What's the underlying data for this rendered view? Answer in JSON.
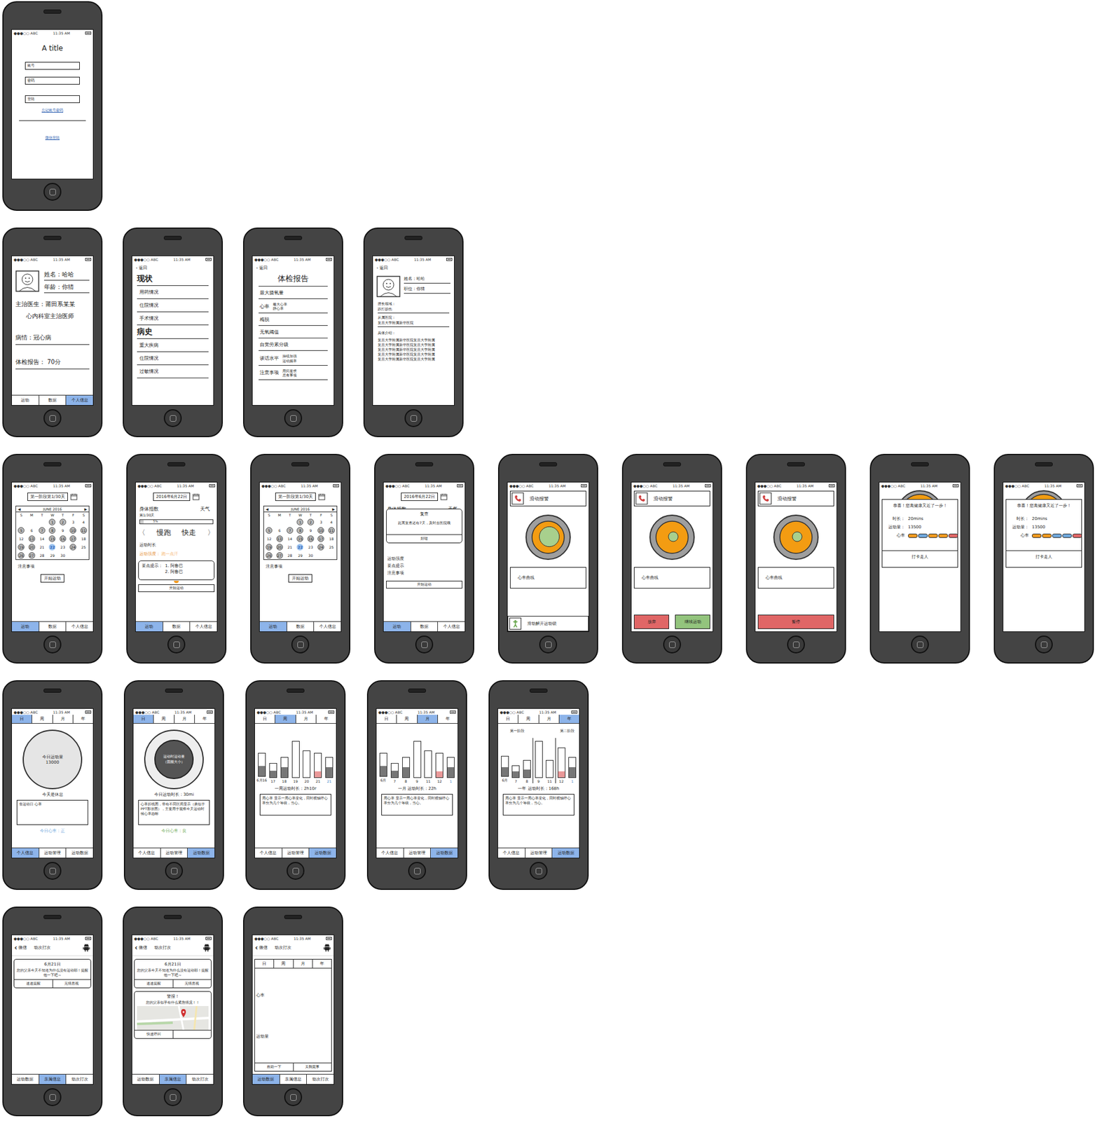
{
  "status_bar": {
    "carrier": "●●●○○ ABC",
    "time": "11:35 AM"
  },
  "calendar": {
    "month": "JUNE 2016",
    "prev": "◀",
    "next": "▶",
    "weekdays": [
      "S",
      "M",
      "T",
      "W",
      "T",
      "F",
      "S"
    ],
    "days": [
      {
        "d": "",
        "done": false,
        "selected": false
      },
      {
        "d": "",
        "done": false,
        "selected": false
      },
      {
        "d": "",
        "done": false,
        "selected": false
      },
      {
        "d": "1",
        "done": true,
        "selected": false
      },
      {
        "d": "2",
        "done": true,
        "selected": false
      },
      {
        "d": "3",
        "done": false,
        "selected": false
      },
      {
        "d": "4",
        "done": false,
        "selected": false
      },
      {
        "d": "5",
        "done": true,
        "selected": false
      },
      {
        "d": "6",
        "done": false,
        "selected": false
      },
      {
        "d": "7",
        "done": true,
        "selected": false
      },
      {
        "d": "8",
        "done": true,
        "selected": false
      },
      {
        "d": "9",
        "done": false,
        "selected": false
      },
      {
        "d": "10",
        "done": true,
        "selected": false
      },
      {
        "d": "11",
        "done": true,
        "selected": false
      },
      {
        "d": "12",
        "done": false,
        "selected": false
      },
      {
        "d": "13",
        "done": true,
        "selected": false
      },
      {
        "d": "14",
        "done": false,
        "selected": false
      },
      {
        "d": "15",
        "done": true,
        "selected": false
      },
      {
        "d": "16",
        "done": true,
        "selected": false
      },
      {
        "d": "17",
        "done": true,
        "selected": false
      },
      {
        "d": "18",
        "done": false,
        "selected": false
      },
      {
        "d": "19",
        "done": true,
        "selected": false
      },
      {
        "d": "20",
        "done": true,
        "selected": false
      },
      {
        "d": "21",
        "done": false,
        "selected": false
      },
      {
        "d": "22",
        "done": false,
        "selected": true
      },
      {
        "d": "23",
        "done": false,
        "selected": false
      },
      {
        "d": "24",
        "done": true,
        "selected": false
      },
      {
        "d": "25",
        "done": false,
        "selected": false
      },
      {
        "d": "26",
        "done": true,
        "selected": false
      },
      {
        "d": "27",
        "done": true,
        "selected": false
      },
      {
        "d": "28",
        "done": false,
        "selected": false
      },
      {
        "d": "29",
        "done": false,
        "selected": false
      },
      {
        "d": "30",
        "done": false,
        "selected": false
      }
    ]
  },
  "screens": [
    {
      "kind": "login",
      "title": "A title",
      "fields": [
        "账号",
        "密码"
      ],
      "button": "登陆",
      "forgot": "忘记账号密码",
      "wechat": "微信登陆"
    },
    {
      "kind": "profile",
      "name": "姓名：哈哈",
      "age": "年龄：你猜",
      "doctor": "主治医生：莆田系某某",
      "dept": "心内科室主治医师",
      "illness": "病情：冠心病",
      "report": "体检报告： 70分",
      "tabs": [
        {
          "label": "运动",
          "selected": false
        },
        {
          "label": "数据",
          "selected": false
        },
        {
          "label": "个人信息",
          "selected": true
        }
      ]
    },
    {
      "kind": "history",
      "back": "返回",
      "sections": [
        {
          "title": "现状",
          "items": [
            "用药情况",
            "住院情况",
            "手术情况"
          ]
        },
        {
          "title": "病史",
          "items": [
            "重大疾病",
            "住院情况",
            "过敏情况"
          ]
        }
      ]
    },
    {
      "kind": "report",
      "back": "返回",
      "title": "体检报告",
      "rows": [
        {
          "label": "最大摄氧量",
          "subs": []
        },
        {
          "label": "心率",
          "subs": [
            "最大心率",
            "静心率"
          ]
        },
        {
          "label": "梅脱",
          "subs": []
        },
        {
          "label": "无氧阈值",
          "subs": []
        },
        {
          "label": "自觉劳累分级",
          "subs": []
        },
        {
          "label": "谈话水平",
          "subs": [
            "持续加强",
            "运动频率"
          ]
        },
        {
          "label": "注意事项",
          "subs": [
            "用药要求",
            "忌食事项"
          ]
        }
      ]
    },
    {
      "kind": "doctor",
      "back": "返回",
      "name": "姓名：哈哈",
      "role": "职位：你猜",
      "fields": [
        {
          "label": "擅长领域：",
          "value": "跌打损伤"
        },
        {
          "label": "从属医院：",
          "value": "复旦大学附属新华医院"
        }
      ],
      "intro_label": "具体介绍：",
      "intro": [
        "复旦大学附属新华医院复旦大学附属",
        "复旦大学附属新华医院复旦大学附属",
        "复旦大学附属新华医院复旦大学附属",
        "复旦大学附属新华医院复旦大学附属",
        "复旦大学附属新华医院复旦大学附属"
      ]
    },
    {
      "kind": "calendar",
      "stage": "第一阶段第1/30天",
      "notes": "注意事项",
      "button": "开始运动",
      "tabs": [
        {
          "label": "运动",
          "selected": true
        },
        {
          "label": "数据",
          "selected": false
        },
        {
          "label": "个人信息",
          "selected": false
        }
      ]
    },
    {
      "kind": "exercise",
      "date": "2016年6月22日",
      "index": "身体指数",
      "weather": "天气",
      "day": "第1/30天",
      "progress": {
        "level": 0.05,
        "reading": "5%"
      },
      "prev": "〈",
      "next": "〉",
      "modes": [
        "慢跑",
        "快走"
      ],
      "duration": "运动时长",
      "intensity_label": "运动强度：",
      "intensity": "跑一点汗",
      "tips_label": "要点提示：",
      "tips": [
        "1. 阿鲁巴",
        "2. 阿鲁巴"
      ],
      "button": "开始运动",
      "tabs": [
        {
          "label": "运动",
          "selected": true
        },
        {
          "label": "数据",
          "selected": false
        },
        {
          "label": "个人信息",
          "selected": false
        }
      ]
    },
    {
      "kind": "calendar",
      "stage": "第一阶段第1/30天",
      "notes": "注意事项",
      "button": "开始运动",
      "tabs": [
        {
          "label": "运动",
          "selected": true
        },
        {
          "label": "数据",
          "selected": false
        },
        {
          "label": "个人信息",
          "selected": false
        }
      ]
    },
    {
      "kind": "reminder",
      "date": "2016年6月22日",
      "index": "身体指数",
      "weather": "天气",
      "day": "第1/30天",
      "labels": [
        "运动强度",
        "要点提示",
        "注意事项"
      ],
      "dialog": {
        "title": "复查",
        "text": "距离复查还有7天，及时去医院哦",
        "button": "好哒"
      },
      "button": "开始运动",
      "tabs": [
        {
          "label": "运动",
          "selected": true
        },
        {
          "label": "数据",
          "selected": false
        },
        {
          "label": "个人信息",
          "selected": false
        }
      ]
    },
    {
      "kind": "workout",
      "alarm": "滑动报警",
      "pulse": {
        "level": 0.62
      },
      "curve": "心率曲线",
      "controls": [
        {
          "kind": "slider",
          "label": "滑动解开运动锁",
          "color": "#ffffff"
        }
      ]
    },
    {
      "kind": "workout",
      "alarm": "滑动报警",
      "pulse": {
        "level": 0.3
      },
      "curve": "心率曲线",
      "controls": [
        {
          "kind": "button",
          "label": "放弃",
          "color": "#e06666"
        },
        {
          "kind": "button",
          "label": "继续运动",
          "color": "#93c47d"
        }
      ]
    },
    {
      "kind": "workout",
      "alarm": "滑动报警",
      "pulse": {
        "level": 0.3
      },
      "curve": "心率曲线",
      "controls": [
        {
          "kind": "button",
          "label": "暂停",
          "color": "#e06666"
        }
      ]
    },
    {
      "kind": "done",
      "title": "恭喜！您离健康又近了一步！",
      "stats": [
        {
          "label": "时长：",
          "value": "20mins"
        },
        {
          "label": "运动量：",
          "value": "13500"
        }
      ],
      "hr_label": "心率",
      "segments": [
        {
          "color": "#f29a1f"
        },
        {
          "color": "#6fa8dc"
        },
        {
          "color": "#f29a1f"
        },
        {
          "color": "#f29a1f"
        },
        {
          "color": "#e06666"
        }
      ],
      "button": "打卡走人"
    },
    {
      "kind": "done",
      "title": "恭喜！您离健康又近了一步！",
      "stats": [
        {
          "label": "时长：",
          "value": "20mins"
        },
        {
          "label": "运动量：",
          "value": "13500"
        }
      ],
      "hr_label": "心率",
      "segments": [
        {
          "color": "#f29a1f"
        },
        {
          "color": "#f29a1f"
        },
        {
          "color": "#6fa8dc"
        },
        {
          "color": "#6fa8dc"
        },
        {
          "color": "#e06666"
        }
      ],
      "button": "打卡走人"
    },
    {
      "kind": "day_rest",
      "periods": [
        {
          "label": "日",
          "selected": true
        },
        {
          "label": "周",
          "selected": false
        },
        {
          "label": "月",
          "selected": false
        },
        {
          "label": "年",
          "selected": false
        }
      ],
      "circle_title": "今日运动量",
      "circle_value": "13000",
      "caption": "今天是休息",
      "box": "非运动日 心率",
      "status": {
        "text": "今日心率：正",
        "color": "#6fa8dc"
      },
      "tabs": [
        {
          "label": "个人信息",
          "selected": true
        },
        {
          "label": "运动管理",
          "selected": false
        },
        {
          "label": "运动数据",
          "selected": false
        }
      ]
    },
    {
      "kind": "day_active",
      "periods": [
        {
          "label": "日",
          "selected": true
        },
        {
          "label": "周",
          "selected": false
        },
        {
          "label": "月",
          "selected": false
        },
        {
          "label": "年",
          "selected": false
        }
      ],
      "circle_text": "运动时运动量（圆圈大小）",
      "caption": "今日运动时长：30mi",
      "box": "心率折线图，带有不同区间显示（类似于PPT那张图），主要用于观察今天运动时候心率趋标",
      "status": {
        "text": "今日心率：良",
        "color": "#6aa84f"
      },
      "tabs": [
        {
          "label": "个人信息",
          "selected": false
        },
        {
          "label": "运动管理",
          "selected": false
        },
        {
          "label": "运动数据",
          "selected": true
        }
      ]
    },
    {
      "kind": "chart",
      "periods": [
        {
          "label": "日",
          "selected": false
        },
        {
          "label": "周",
          "selected": true
        },
        {
          "label": "月",
          "selected": false
        },
        {
          "label": "年",
          "selected": false
        }
      ],
      "phases": [],
      "bars": [
        {
          "label": "6月16",
          "total": 45,
          "base": 20,
          "alert": false,
          "today": false,
          "divider": false
        },
        {
          "label": "17",
          "total": 28,
          "base": 14,
          "alert": false,
          "today": false,
          "divider": false
        },
        {
          "label": "18",
          "total": 40,
          "base": 20,
          "alert": false,
          "today": false,
          "divider": false
        },
        {
          "label": "19",
          "total": 70,
          "base": 0,
          "alert": false,
          "today": false,
          "divider": false
        },
        {
          "label": "20",
          "total": 52,
          "base": 0,
          "alert": false,
          "today": false,
          "divider": false
        },
        {
          "label": "21",
          "total": 48,
          "base": 12,
          "alert": true,
          "today": false,
          "divider": false
        },
        {
          "label": "21",
          "total": 40,
          "base": 20,
          "alert": false,
          "today": true,
          "divider": false
        }
      ],
      "caption": "一周运动时长：2h10r",
      "box": "周心率 显示一周心率变化，同时横轴呼心率分为几个等级，当心。",
      "tabs": [
        {
          "label": "个人信息",
          "selected": false
        },
        {
          "label": "运动管理",
          "selected": false
        },
        {
          "label": "运动数据",
          "selected": true
        }
      ]
    },
    {
      "kind": "chart",
      "periods": [
        {
          "label": "日",
          "selected": false
        },
        {
          "label": "周",
          "selected": false
        },
        {
          "label": "月",
          "selected": true
        },
        {
          "label": "年",
          "selected": false
        }
      ],
      "phases": [],
      "bars": [
        {
          "label": "6月",
          "total": 45,
          "base": 20,
          "alert": false,
          "today": false,
          "divider": false
        },
        {
          "label": "7",
          "total": 28,
          "base": 14,
          "alert": false,
          "today": false,
          "divider": false
        },
        {
          "label": "8",
          "total": 40,
          "base": 20,
          "alert": false,
          "today": false,
          "divider": false
        },
        {
          "label": "9",
          "total": 70,
          "base": 0,
          "alert": false,
          "today": false,
          "divider": false
        },
        {
          "label": "11",
          "total": 52,
          "base": 0,
          "alert": false,
          "today": false,
          "divider": false
        },
        {
          "label": "12",
          "total": 48,
          "base": 12,
          "alert": true,
          "today": false,
          "divider": false
        },
        {
          "label": "1",
          "total": 40,
          "base": 20,
          "alert": false,
          "today": true,
          "divider": false
        }
      ],
      "caption": "一月 运动时长：22h",
      "box": "周心率 显示一周心率变化，同时横轴呼心率分为几个等级，当心。",
      "tabs": [
        {
          "label": "个人信息",
          "selected": false
        },
        {
          "label": "运动管理",
          "selected": false
        },
        {
          "label": "运动数据",
          "selected": true
        }
      ]
    },
    {
      "kind": "chart",
      "periods": [
        {
          "label": "日",
          "selected": false
        },
        {
          "label": "周",
          "selected": false
        },
        {
          "label": "月",
          "selected": false
        },
        {
          "label": "年",
          "selected": true
        }
      ],
      "phases": [
        "第一阶段",
        "第二阶段"
      ],
      "bars": [
        {
          "label": "6月",
          "total": 40,
          "base": 18,
          "alert": false,
          "today": false,
          "divider": false
        },
        {
          "label": "7",
          "total": 24,
          "base": 12,
          "alert": false,
          "today": false,
          "divider": false
        },
        {
          "label": "8",
          "total": 34,
          "base": 16,
          "alert": false,
          "today": false,
          "divider": false
        },
        {
          "label": "9",
          "total": 70,
          "base": 0,
          "alert": false,
          "today": false,
          "divider": true
        },
        {
          "label": "11",
          "total": 34,
          "base": 0,
          "alert": false,
          "today": false,
          "divider": false
        },
        {
          "label": "12",
          "total": 58,
          "base": 12,
          "alert": true,
          "today": false,
          "divider": true
        },
        {
          "label": "1",
          "total": 40,
          "base": 20,
          "alert": false,
          "today": true,
          "divider": false
        }
      ],
      "caption": "一年 运动时长：168h",
      "box": "周心率 显示一周心率变化，同时横轴呼心率分为几个等级，当心。",
      "tabs": [
        {
          "label": "个人信息",
          "selected": false
        },
        {
          "label": "运动管理",
          "selected": false
        },
        {
          "label": "运动数据",
          "selected": true
        }
      ]
    },
    {
      "kind": "family",
      "nav": {
        "back": "微信",
        "title": "动次打次"
      },
      "cards": [
        {
          "kind": "notice",
          "title": "6月21日",
          "text": "您的父亲今天不知道为什么没有运动耶！提醒他一下吧~",
          "buttons": [
            "速速提醒",
            "无情忽视"
          ]
        }
      ],
      "tabs": [
        {
          "label": "运动数据",
          "selected": false
        },
        {
          "label": "亲属信息",
          "selected": true
        },
        {
          "label": "动次打次",
          "selected": false
        }
      ]
    },
    {
      "kind": "family",
      "nav": {
        "back": "微信",
        "title": "动次打次"
      },
      "cards": [
        {
          "kind": "notice",
          "title": "6月21日",
          "text": "您的父亲今天不知道为什么没有运动耶！提醒他一下吧~",
          "buttons": [
            "速速提醒",
            "无情忽视"
          ]
        },
        {
          "kind": "alert",
          "title": "警报！",
          "text": "您的父亲似乎有什么紧急情况！！",
          "buttons": [
            "快速呼叫"
          ]
        }
      ],
      "tabs": [
        {
          "label": "运动数据",
          "selected": false
        },
        {
          "label": "亲属信息",
          "selected": true
        },
        {
          "label": "动次打次",
          "selected": false
        }
      ]
    },
    {
      "kind": "family_data",
      "nav": {
        "back": "微信",
        "title": "动次打次"
      },
      "periods": [
        {
          "label": "日",
          "selected": false
        },
        {
          "label": "周",
          "selected": false
        },
        {
          "label": "月",
          "selected": false
        },
        {
          "label": "年",
          "selected": false
        }
      ],
      "labels": [
        "心率",
        "运动量"
      ],
      "buttons": [
        "救助一下",
        "关我屁事"
      ],
      "tabs": [
        {
          "label": "运动数据",
          "selected": true
        },
        {
          "label": "亲属信息",
          "selected": false
        },
        {
          "label": "动次打次",
          "selected": false
        }
      ]
    }
  ]
}
